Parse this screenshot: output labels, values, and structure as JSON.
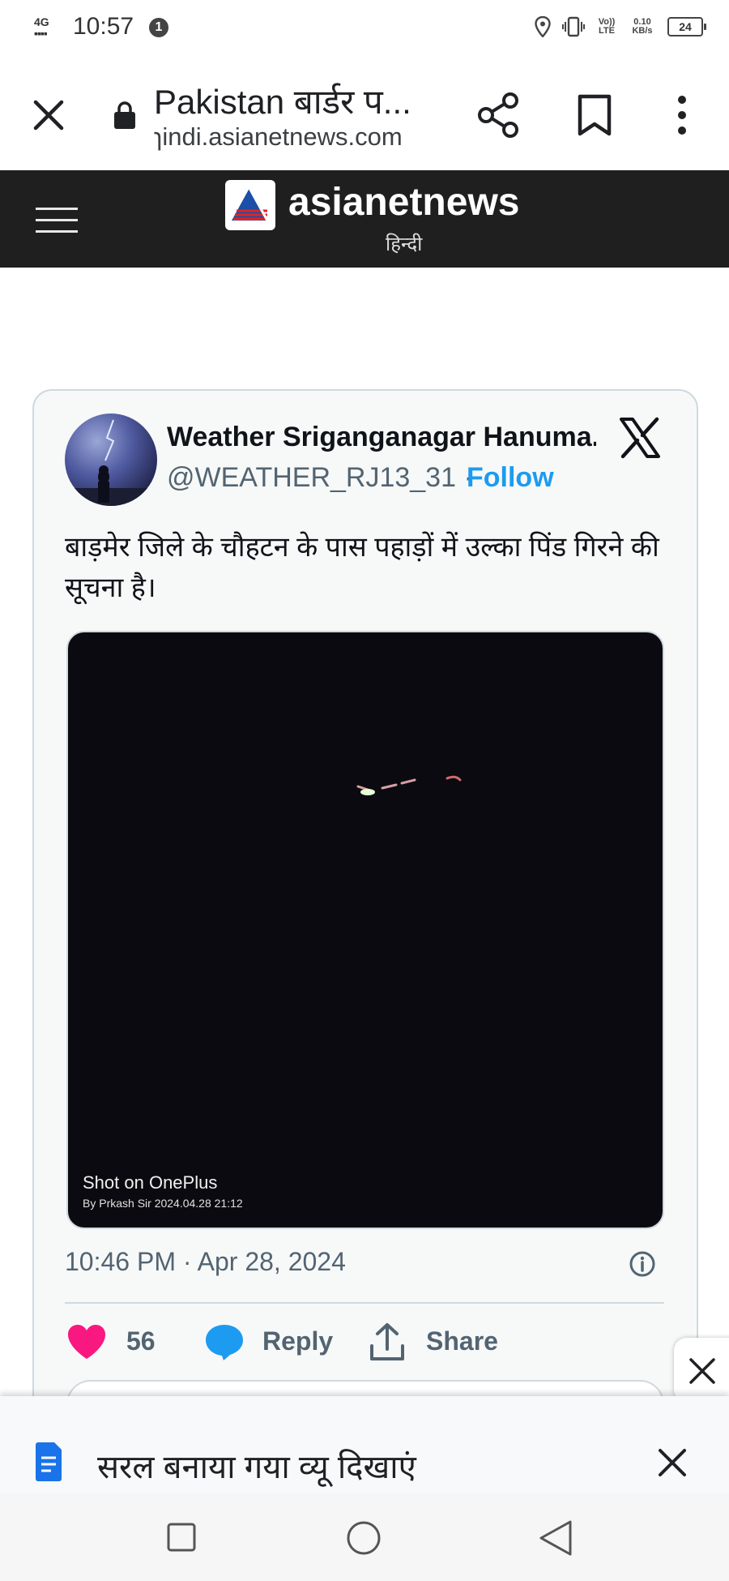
{
  "status_bar": {
    "network": "4G",
    "time": "10:57",
    "notification_count": "1",
    "volte_label": "Vo)) LTE",
    "data_speed": "0.10 KB/s",
    "battery": "24"
  },
  "toolbar": {
    "title": "Pakistan बार्डर प...",
    "url": "ɿindi.asianetnews.com",
    "icons": [
      "close-icon",
      "lock-icon",
      "share-icon",
      "bookmark-icon",
      "more-vert-icon"
    ]
  },
  "site_header": {
    "brand": "asianetnews",
    "sub": "हिन्दी"
  },
  "tweet": {
    "author_name": "Weather Sriganganagar Hanuma...",
    "handle": "@WEATHER_RJ13_31 ·",
    "follow_label": "Follow",
    "text": "बाड़मेर जिले के चौहटन के पास पहाड़ों में उल्का पिंड गिरने की सूचना है।",
    "media_watermark_1": "Shot on OnePlus",
    "media_watermark_2": "By Prkash Sir   2024.04.28 21:12",
    "timestamp": "10:46 PM · Apr 28, 2024",
    "likes": "56",
    "reply_label": "Reply",
    "share_label": "Share"
  },
  "simplified_view": {
    "label": "सरल बनाया गया व्यू दिखाएं"
  },
  "colors": {
    "header_bg": "#1f1f1f",
    "follow": "#1d9bf0",
    "heart": "#f91880",
    "secondary_text": "#536471"
  }
}
